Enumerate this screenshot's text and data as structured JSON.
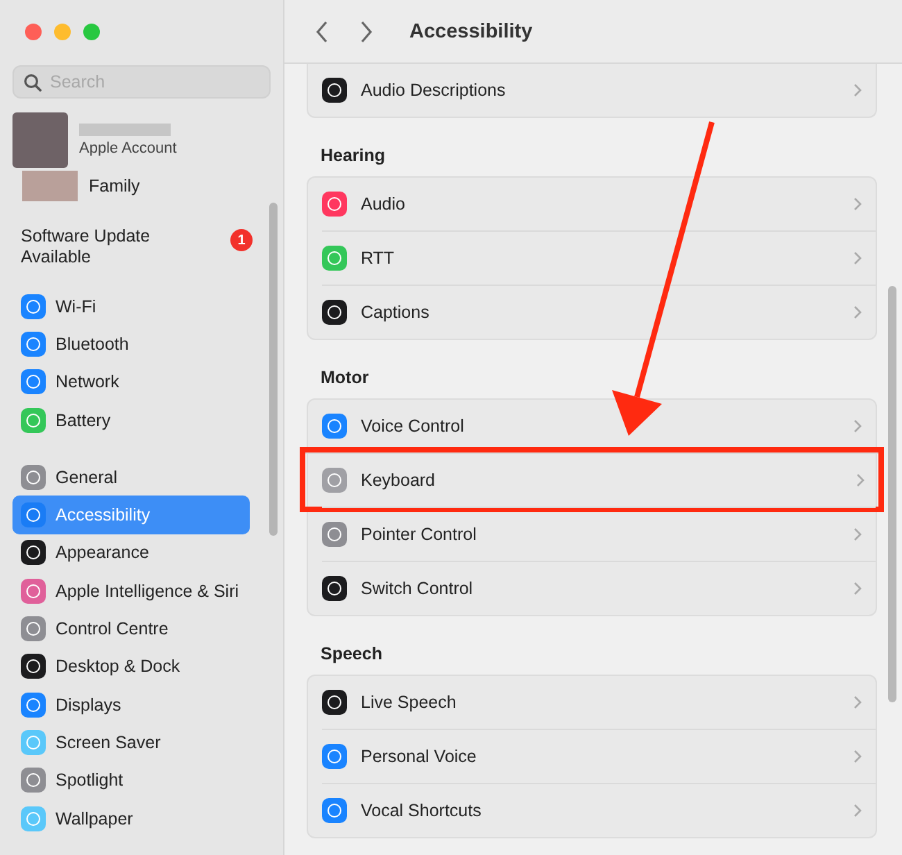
{
  "window": {
    "title": "Accessibility"
  },
  "sidebar": {
    "search": {
      "placeholder": "Search"
    },
    "account": {
      "label": "Apple Account"
    },
    "family": {
      "label": "Family"
    },
    "update": {
      "label": "Software Update Available",
      "badge": "1"
    },
    "groups": [
      {
        "items": [
          {
            "label": "Wi-Fi",
            "color": "#1a84ff",
            "selected": false
          },
          {
            "label": "Bluetooth",
            "color": "#1a84ff",
            "selected": false
          },
          {
            "label": "Network",
            "color": "#1a84ff",
            "selected": false
          },
          {
            "label": "Battery",
            "color": "#34c759",
            "selected": false
          }
        ]
      },
      {
        "items": [
          {
            "label": "General",
            "color": "#8e8e93",
            "selected": false
          },
          {
            "label": "Accessibility",
            "color": "#1a7cf5",
            "selected": true
          },
          {
            "label": "Appearance",
            "color": "#1c1c1e",
            "selected": false
          },
          {
            "label": "Apple Intelligence & Siri",
            "color": "#e0609a",
            "selected": false
          },
          {
            "label": "Control Centre",
            "color": "#8e8e93",
            "selected": false
          },
          {
            "label": "Desktop & Dock",
            "color": "#1c1c1e",
            "selected": false
          },
          {
            "label": "Displays",
            "color": "#1a84ff",
            "selected": false
          },
          {
            "label": "Screen Saver",
            "color": "#5ac8fa",
            "selected": false
          },
          {
            "label": "Spotlight",
            "color": "#8e8e93",
            "selected": false
          },
          {
            "label": "Wallpaper",
            "color": "#5ac8fa",
            "selected": false
          }
        ]
      }
    ]
  },
  "sections": [
    {
      "rows": [
        {
          "label": "Audio Descriptions",
          "color": "#1c1c1e",
          "highlighted": false
        }
      ]
    },
    {
      "heading": "Hearing",
      "rows": [
        {
          "label": "Audio",
          "color": "#ff375f",
          "highlighted": false
        },
        {
          "label": "RTT",
          "color": "#34c759",
          "highlighted": false
        },
        {
          "label": "Captions",
          "color": "#1c1c1e",
          "highlighted": false
        }
      ]
    },
    {
      "heading": "Motor",
      "rows": [
        {
          "label": "Voice Control",
          "color": "#1a84ff",
          "highlighted": false
        },
        {
          "label": "Keyboard",
          "color": "#a0a0a5",
          "highlighted": true
        },
        {
          "label": "Pointer Control",
          "color": "#8e8e93",
          "highlighted": false
        },
        {
          "label": "Switch Control",
          "color": "#1c1c1e",
          "highlighted": false
        }
      ]
    },
    {
      "heading": "Speech",
      "rows": [
        {
          "label": "Live Speech",
          "color": "#1c1c1e",
          "highlighted": false
        },
        {
          "label": "Personal Voice",
          "color": "#1a84ff",
          "highlighted": false
        },
        {
          "label": "Vocal Shortcuts",
          "color": "#1a84ff",
          "highlighted": false
        }
      ]
    }
  ]
}
